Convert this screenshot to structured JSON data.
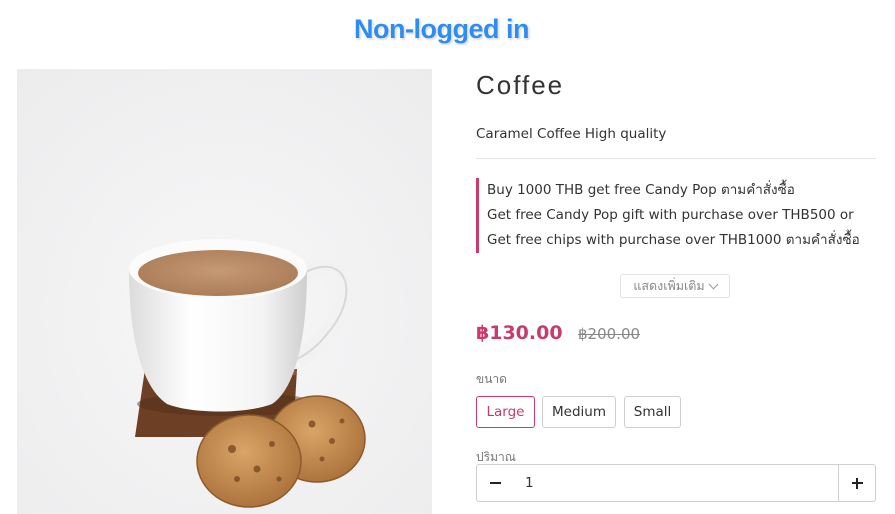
{
  "banner": "Non-logged in",
  "product": {
    "title": "Coffee",
    "description": "Caramel Coffee High quality",
    "image_icon": "coffee-cup-with-cookies-photo"
  },
  "promotions": [
    "Buy 1000 THB get free Candy Pop ตามคำสั่งซื้อ",
    "Get free Candy Pop gift with purchase over THB500 or Get free chips with purchase over THB1000 ตามคำสั่งซื้อ"
  ],
  "show_more_label": "แสดงเพิ่มเติม",
  "price": {
    "current": "฿130.00",
    "original": "฿200.00"
  },
  "size": {
    "label": "ขนาด",
    "options": [
      "Large",
      "Medium",
      "Small"
    ],
    "selected": "Large"
  },
  "quantity": {
    "label": "ปริมาณ",
    "value": "1"
  },
  "colors": {
    "accent": "#c93b68",
    "banner": "#2f8cf0"
  }
}
